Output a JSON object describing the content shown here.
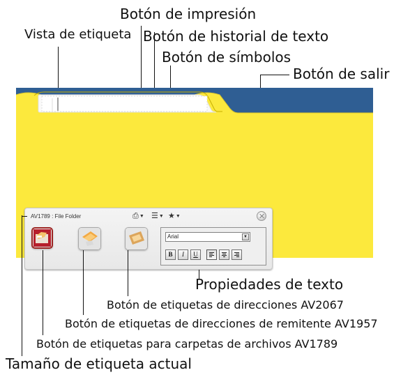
{
  "callouts": {
    "print_button": "Botón de impresión",
    "label_view": "Vista de etiqueta",
    "text_history_button": "Botón de historial de texto",
    "symbols_button": "Botón de símbolos",
    "exit_button": "Botón de salir",
    "text_properties": "Propiedades de texto",
    "address_labels_button": "Botón de etiquetas de direcciones AV2067",
    "return_address_labels_button": "Botón de etiquetas de direcciones de remitente AV1957",
    "file_folder_labels_button": "Botón de etiquetas para carpetas de archivos AV1789",
    "current_label_size": "Tamaño de etiqueta actual"
  },
  "app": {
    "current_size": "AV1789 : File Folder",
    "font_value": "Arial",
    "format_buttons": [
      "B",
      "I",
      "U"
    ],
    "align_buttons": [
      "left",
      "center",
      "right"
    ],
    "label_buttons": [
      {
        "name": "file-folder",
        "active": true
      },
      {
        "name": "return-address",
        "active": false
      },
      {
        "name": "address",
        "active": false
      }
    ]
  },
  "colors": {
    "folder_yellow": "#fce93d",
    "folder_blue": "#2f5e93",
    "active_red": "#9c2421"
  },
  "icons": {
    "print": "print-icon",
    "history": "history-icon",
    "symbols": "star-icon",
    "exit": "close-icon"
  }
}
